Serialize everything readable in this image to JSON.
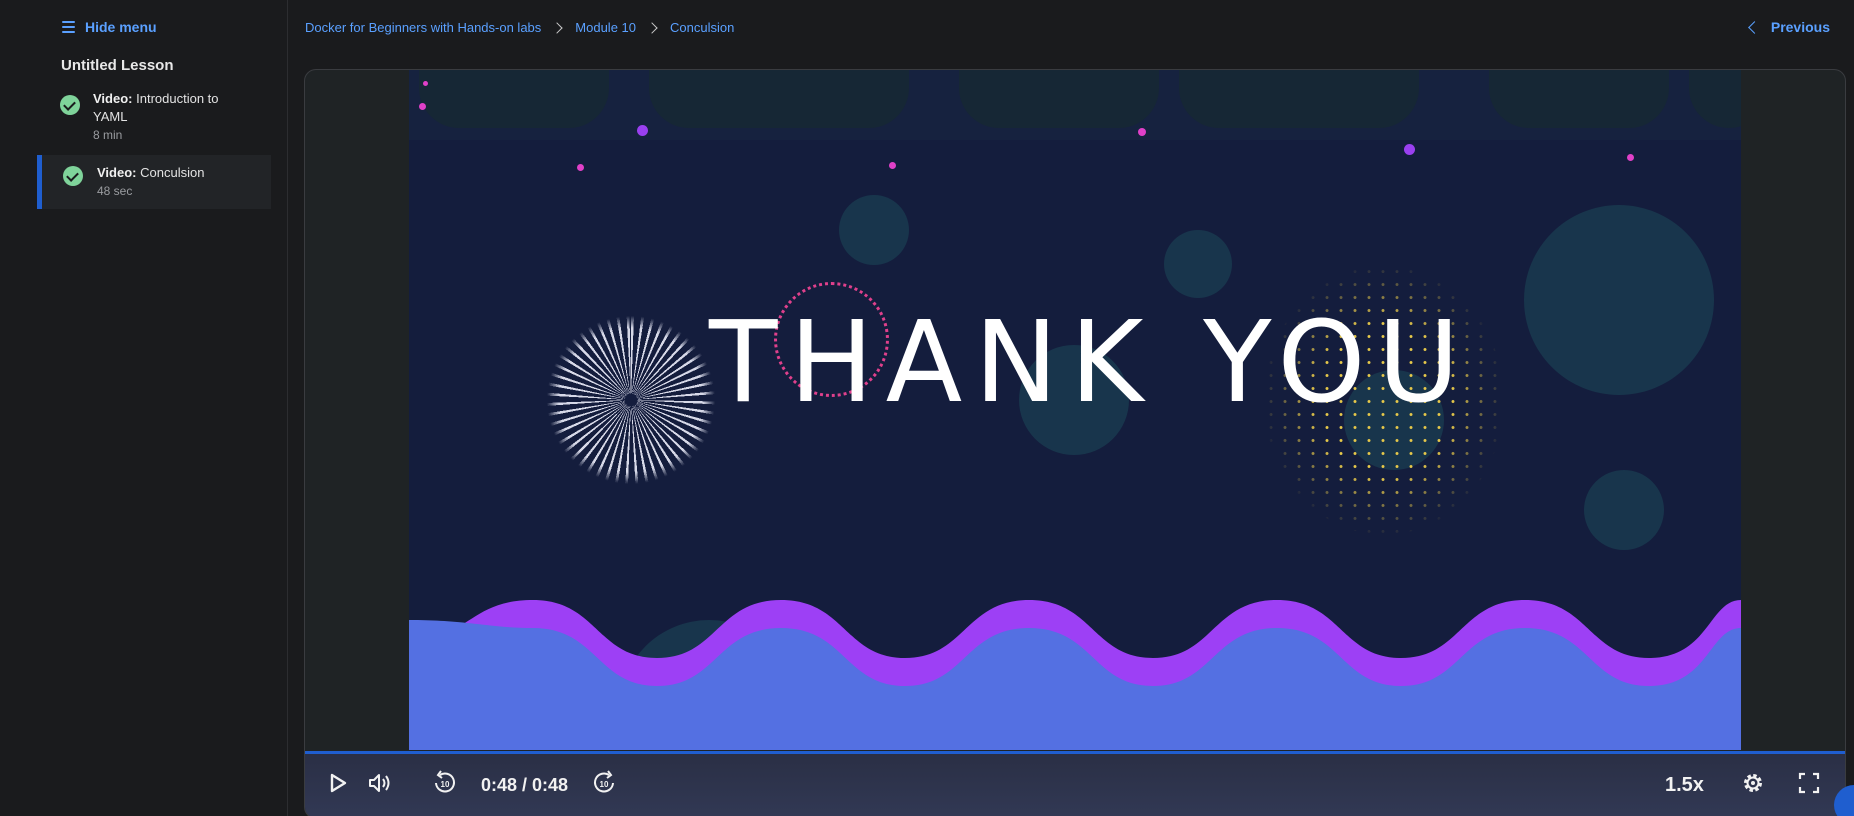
{
  "sidebar": {
    "hide_menu_label": "Hide menu",
    "lesson_title": "Untitled Lesson",
    "items": [
      {
        "kind": "Video:",
        "title": "Introduction to YAML",
        "duration": "8 min",
        "completed": true,
        "active": false
      },
      {
        "kind": "Video:",
        "title": "Conculsion",
        "duration": "48 sec",
        "completed": true,
        "active": true
      }
    ]
  },
  "breadcrumb": [
    "Docker for Beginners with Hands-on labs",
    "Module 10",
    "Conculsion"
  ],
  "nav": {
    "previous_label": "Previous"
  },
  "video": {
    "slide_text": "THANK YOU",
    "time_display": "0:48 / 0:48",
    "speed": "1.5x",
    "progress": 1.0,
    "rewind_seconds": "10",
    "forward_seconds": "10"
  },
  "colors": {
    "accent": "#5aa0ff",
    "active_bar": "#1f5ecf",
    "check": "#7fd39a",
    "wave_purple": "#9d40f5",
    "wave_blue": "#5470e2",
    "slide_bg": "#141d3d"
  },
  "icons": {
    "menu": "hamburger-icon",
    "completed": "check-circle-icon",
    "previous": "chevron-left-icon",
    "play": "play-icon",
    "volume": "volume-icon",
    "rewind": "rewind-10-icon",
    "forward": "forward-10-icon",
    "settings": "gear-icon",
    "fullscreen": "fullscreen-icon"
  }
}
